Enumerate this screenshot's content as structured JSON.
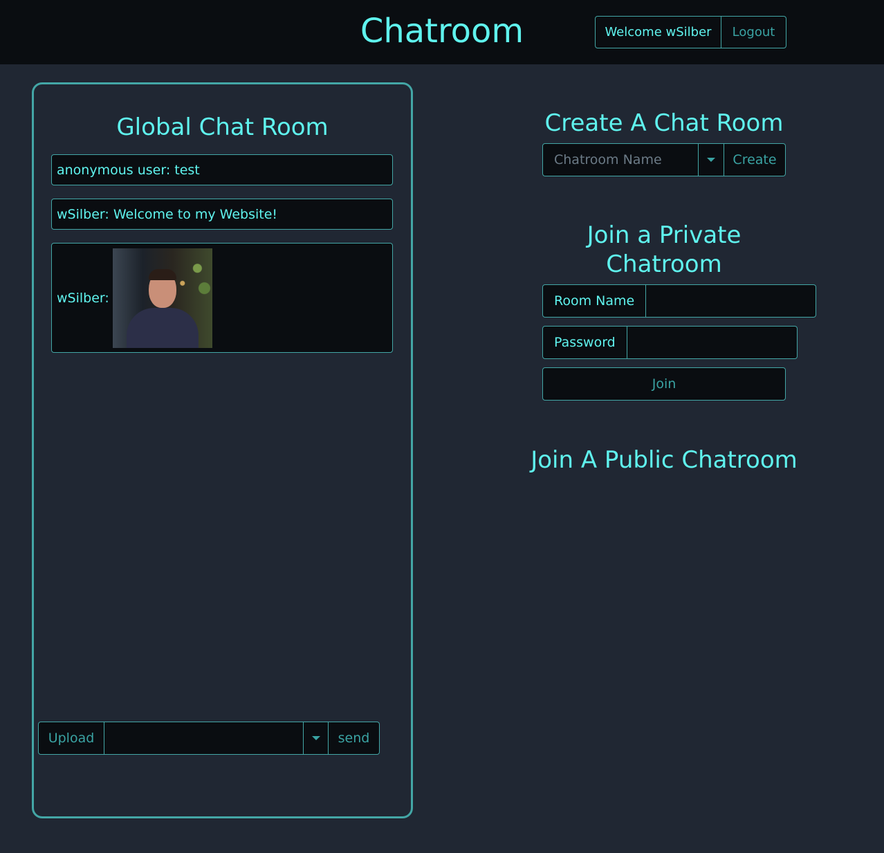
{
  "header": {
    "title": "Chatroom",
    "welcome_label": "Welcome wSilber",
    "logout_label": "Logout"
  },
  "global_chat": {
    "title": "Global Chat Room",
    "messages": [
      {
        "text": "anonymous user: test"
      },
      {
        "text": "wSilber: Welcome to my Website!"
      },
      {
        "sender": "wSilber:",
        "image": "profile-photo"
      }
    ],
    "upload_label": "Upload",
    "message_input_value": "",
    "send_label": "send"
  },
  "create_room": {
    "title": "Create A Chat Room",
    "name_placeholder": "Chatroom Name",
    "create_label": "Create"
  },
  "private_room": {
    "title_line1": "Join a Private",
    "title_line2": "Chatroom",
    "room_name_label": "Room Name",
    "room_name_value": "",
    "password_label": "Password",
    "password_value": "",
    "join_label": "Join"
  },
  "public_room": {
    "title": "Join A Public Chatroom"
  },
  "colors": {
    "accent": "#5ff3ee",
    "muted_accent": "#3aa3a3",
    "border": "#43a6a6",
    "page_bg": "#202733",
    "bar_bg": "#0a0d11"
  }
}
